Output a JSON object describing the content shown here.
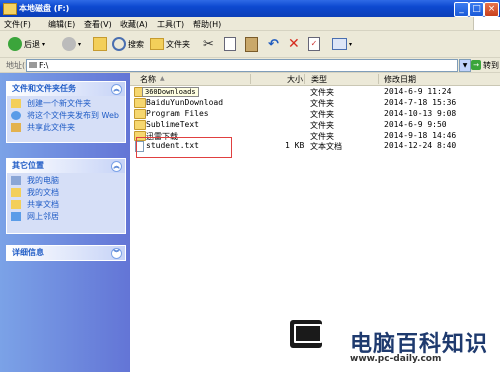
{
  "window": {
    "title": "本地磁盘 (F:)"
  },
  "menu": [
    "文件(F)",
    "编辑(E)",
    "查看(V)",
    "收藏(A)",
    "工具(T)",
    "帮助(H)"
  ],
  "toolbar": {
    "back_label": "后退",
    "search_label": "搜索",
    "folders_label": "文件夹"
  },
  "address": {
    "label": "地址(D)",
    "value": "F:\\",
    "go_label": "转到"
  },
  "panes": {
    "tasks": {
      "title": "文件和文件夹任务",
      "items": [
        "创建一个新文件夹",
        "将这个文件夹发布到 Web",
        "共享此文件夹"
      ]
    },
    "other": {
      "title": "其它位置",
      "items": [
        "我的电脑",
        "我的文档",
        "共享文档",
        "网上邻居"
      ]
    },
    "details": {
      "title": "详细信息"
    }
  },
  "columns": {
    "name": "名称",
    "size": "大小",
    "type": "类型",
    "modified": "修改日期"
  },
  "tooltip": "360Downloads",
  "files": [
    {
      "name": "360Downloads",
      "size": "",
      "type": "文件夹",
      "modified": "2014-6-9 11:24"
    },
    {
      "name": "BaiduYunDownload",
      "size": "",
      "type": "文件夹",
      "modified": "2014-7-18 15:36"
    },
    {
      "name": "Program Files",
      "size": "",
      "type": "文件夹",
      "modified": "2014-10-13 9:08"
    },
    {
      "name": "SublimeText",
      "size": "",
      "type": "文件夹",
      "modified": "2014-6-9 9:50"
    },
    {
      "name": "迅雷下载",
      "size": "",
      "type": "文件夹",
      "modified": "2014-9-18 14:46"
    },
    {
      "name": "student.txt",
      "size": "1 KB",
      "type": "文本文档",
      "modified": "2014-12-24 8:40"
    }
  ],
  "watermark": {
    "brand": "电脑百科知识",
    "url": "www.pc-daily.com"
  }
}
